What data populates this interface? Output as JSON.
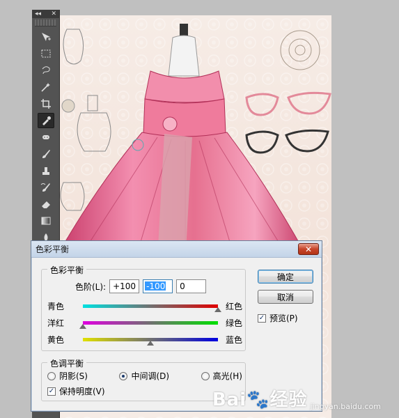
{
  "dialog": {
    "title": "色彩平衡",
    "close_icon": "close-icon",
    "color_balance_group": {
      "legend": "色彩平衡",
      "levels_label": "色阶(L):",
      "levels": [
        "+100",
        "-100",
        "0"
      ],
      "sliders": [
        {
          "left": "青色",
          "right": "红色",
          "value": 100,
          "from": "#00e0e0",
          "to": "#e00000"
        },
        {
          "left": "洋红",
          "right": "绿色",
          "value": -100,
          "from": "#e000e0",
          "to": "#00e000"
        },
        {
          "left": "黄色",
          "right": "蓝色",
          "value": 0,
          "from": "#e0e000",
          "to": "#0000e0"
        }
      ]
    },
    "tone_group": {
      "legend": "色调平衡",
      "options": [
        {
          "label": "阴影(S)",
          "selected": false
        },
        {
          "label": "中间调(D)",
          "selected": true
        },
        {
          "label": "高光(H)",
          "selected": false
        }
      ],
      "preserve_label": "保持明度(V)",
      "preserve_checked": true
    },
    "ok_label": "确定",
    "cancel_label": "取消",
    "preview_label": "预览(P)",
    "preview_checked": true
  },
  "toolbar": {
    "collapse_glyph": "◂◂",
    "close_glyph": "✕",
    "tools": [
      {
        "name": "move-tool-icon",
        "active": false
      },
      {
        "name": "marquee-tool-icon",
        "active": false
      },
      {
        "name": "lasso-tool-icon",
        "active": false
      },
      {
        "name": "magic-wand-tool-icon",
        "active": false
      },
      {
        "name": "crop-tool-icon",
        "active": false
      },
      {
        "name": "eyedropper-tool-icon",
        "active": true
      },
      {
        "name": "healing-tool-icon",
        "active": false
      },
      {
        "name": "brush-tool-icon",
        "active": false
      },
      {
        "name": "stamp-tool-icon",
        "active": false
      },
      {
        "name": "history-brush-tool-icon",
        "active": false
      },
      {
        "name": "eraser-tool-icon",
        "active": false
      },
      {
        "name": "gradient-tool-icon",
        "active": false
      },
      {
        "name": "blur-tool-icon",
        "active": false
      }
    ]
  },
  "watermark": {
    "main": "Bai",
    "paw": "🐾",
    "after": "经验",
    "sub": "jingyan.baidu.com"
  },
  "colors": {
    "dialog_bg": "#f0f0f0",
    "title_bar": "#c3d4e8",
    "close_button": "#c8452a",
    "selection": "#3399ff",
    "dress_pink": "#e2648a"
  }
}
